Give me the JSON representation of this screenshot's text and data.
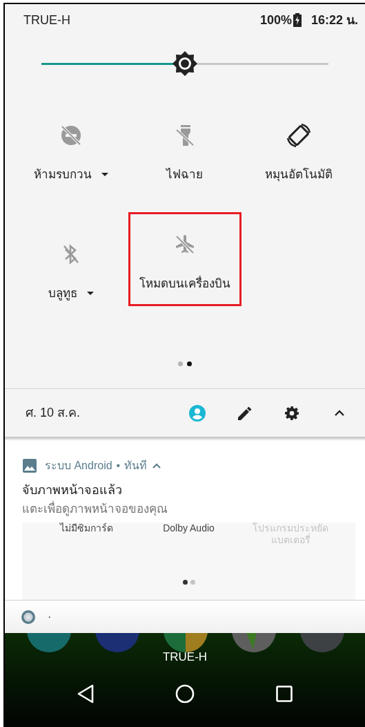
{
  "status_bar": {
    "carrier": "TRUE-H",
    "battery": "100%",
    "time": "16:22 น."
  },
  "brightness": {
    "level": 0.5
  },
  "tiles": [
    {
      "kind": "dnd",
      "label": "ห้ามรบกวน",
      "on": false,
      "has_dropdown": true,
      "highlighted": false
    },
    {
      "kind": "flashlight",
      "label": "ไฟฉาย",
      "on": false,
      "has_dropdown": false,
      "highlighted": false
    },
    {
      "kind": "rotate",
      "label": "หมุนอัตโนมัติ",
      "on": true,
      "has_dropdown": false,
      "highlighted": false
    },
    {
      "kind": "bluetooth",
      "label": "บลูทูธ",
      "on": false,
      "has_dropdown": true,
      "highlighted": false
    },
    {
      "kind": "airplane",
      "label": "โหมดบนเครื่องบิน",
      "on": false,
      "has_dropdown": false,
      "highlighted": true
    }
  ],
  "page_dots": [
    {
      "selected": false
    },
    {
      "selected": true
    }
  ],
  "footer": {
    "date": "ศ. 10 ส.ค."
  },
  "notification": {
    "app": "ระบบ Android",
    "separator": "•",
    "time": "ทันที",
    "title": "จับภาพหน้าจอแล้ว",
    "text": "แตะเพื่อดูภาพหน้าจอของคุณ",
    "preview": {
      "tiles": [
        {
          "label": "ไม่มีซิมการ์ด",
          "disabled": false
        },
        {
          "label": "Dolby Audio",
          "disabled": false
        },
        {
          "label": "โปรแกรมประหยัด แบตเตอรี่",
          "disabled": true
        }
      ],
      "page_dots": [
        {
          "selected": true
        },
        {
          "selected": false
        }
      ]
    }
  },
  "second_notification": {
    "text": "·"
  },
  "home": {
    "label": "TRUE-H"
  }
}
